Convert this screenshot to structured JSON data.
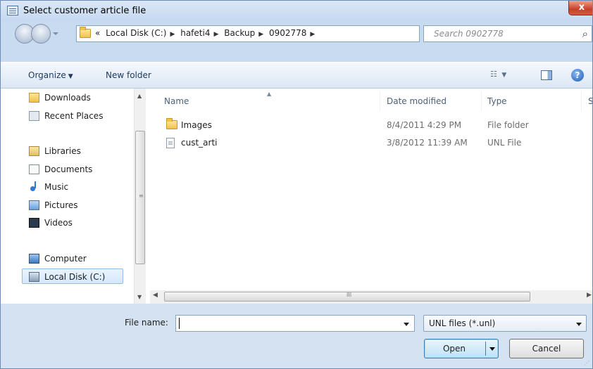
{
  "window": {
    "title": "Select customer article file",
    "close_label": "x"
  },
  "address": {
    "overflow": "«",
    "crumbs": [
      "Local Disk (C:)",
      "hafeti4",
      "Backup",
      "0902778"
    ],
    "search_placeholder": "Search 0902778"
  },
  "toolbar": {
    "organize_label": "Organize",
    "new_folder_label": "New folder",
    "help_label": "?"
  },
  "nav": {
    "items": [
      {
        "label": "Downloads",
        "icon": "downloads-folder-icon"
      },
      {
        "label": "Recent Places",
        "icon": "recent-places-icon"
      },
      {
        "label": "Libraries",
        "icon": "libraries-icon"
      },
      {
        "label": "Documents",
        "icon": "documents-icon"
      },
      {
        "label": "Music",
        "icon": "music-icon"
      },
      {
        "label": "Pictures",
        "icon": "pictures-icon"
      },
      {
        "label": "Videos",
        "icon": "videos-icon"
      },
      {
        "label": "Computer",
        "icon": "computer-icon"
      },
      {
        "label": "Local Disk (C:)",
        "icon": "local-disk-icon",
        "selected": true
      }
    ]
  },
  "files": {
    "columns": {
      "name": "Name",
      "date": "Date modified",
      "type": "Type",
      "size": "S"
    },
    "rows": [
      {
        "name": "Images",
        "date": "8/4/2011 4:29 PM",
        "type": "File folder",
        "icon": "folder-icon"
      },
      {
        "name": "cust_arti",
        "date": "3/8/2012 11:39 AM",
        "type": "UNL File",
        "icon": "file-icon"
      }
    ]
  },
  "bottom": {
    "file_name_label": "File name:",
    "file_name_value": "",
    "filter_value": "UNL files (*.unl)",
    "open_label": "Open",
    "cancel_label": "Cancel"
  },
  "colors": {
    "accent": "#3c7fb1",
    "frame": "#c9dbee",
    "selection": "#d6e8fc"
  }
}
